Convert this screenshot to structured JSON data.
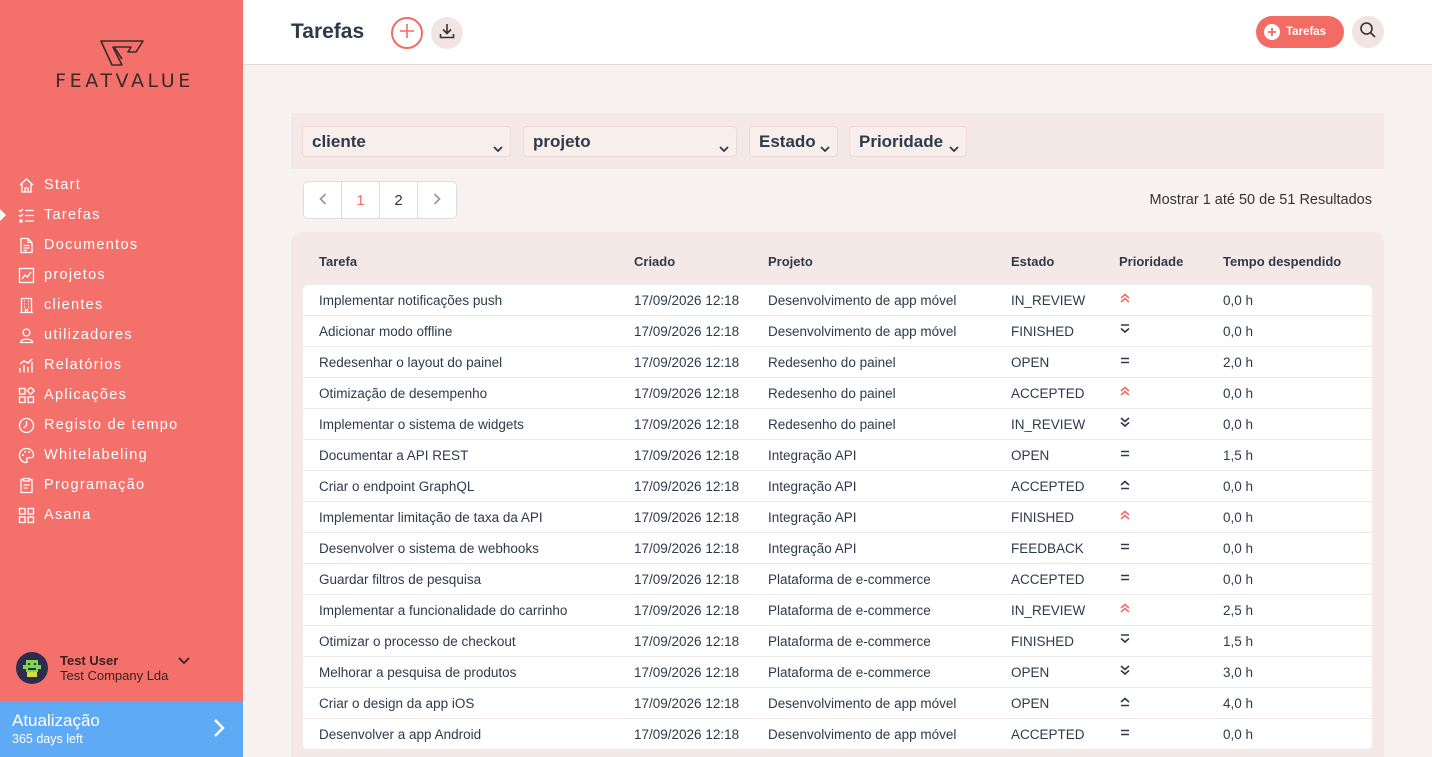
{
  "brand": {
    "name": "FEATVALUE"
  },
  "sidebar": {
    "items": [
      {
        "label": "Start",
        "icon": "home-icon"
      },
      {
        "label": "Tarefas",
        "icon": "task-list-icon",
        "active": true
      },
      {
        "label": "Documentos",
        "icon": "document-icon"
      },
      {
        "label": "projetos",
        "icon": "chart-icon"
      },
      {
        "label": "clientes",
        "icon": "building-icon"
      },
      {
        "label": "utilizadores",
        "icon": "user-icon"
      },
      {
        "label": "Relatórios",
        "icon": "bar-chart-icon"
      },
      {
        "label": "Aplicações",
        "icon": "apps-icon"
      },
      {
        "label": "Registo de tempo",
        "icon": "clock-icon"
      },
      {
        "label": "Whitelabeling",
        "icon": "palette-icon"
      },
      {
        "label": "Programação",
        "icon": "clipboard-icon"
      },
      {
        "label": "Asana",
        "icon": "grid-icon"
      }
    ],
    "user": {
      "name": "Test User",
      "company": "Test Company Lda"
    },
    "upgrade": {
      "title": "Atualização",
      "subtitle": "365 days left"
    }
  },
  "header": {
    "title": "Tarefas",
    "tarefas_button": "Tarefas"
  },
  "filters": {
    "cliente": "cliente",
    "projeto": "projeto",
    "estado": "Estado",
    "prioridade": "Prioridade"
  },
  "pagination": {
    "pages": [
      "1",
      "2"
    ],
    "current": "1",
    "results_text": "Mostrar 1 até 50 de 51 Resultados"
  },
  "table": {
    "columns": [
      "Tarefa",
      "Criado",
      "Projeto",
      "Estado",
      "Prioridade",
      "Tempo despendido"
    ],
    "rows": [
      {
        "tarefa": "Implementar notificações push",
        "criado": "17/09/2026 12:18",
        "projeto": "Desenvolvimento de app móvel",
        "estado": "IN_REVIEW",
        "prioridade": "highest",
        "tempo": "0,0 h"
      },
      {
        "tarefa": "Adicionar modo offline",
        "criado": "17/09/2026 12:18",
        "projeto": "Desenvolvimento de app móvel",
        "estado": "FINISHED",
        "prioridade": "low",
        "tempo": "0,0 h"
      },
      {
        "tarefa": "Redesenhar o layout do painel",
        "criado": "17/09/2026 12:18",
        "projeto": "Redesenho do painel",
        "estado": "OPEN",
        "prioridade": "medium",
        "tempo": "2,0 h"
      },
      {
        "tarefa": "Otimização de desempenho",
        "criado": "17/09/2026 12:18",
        "projeto": "Redesenho do painel",
        "estado": "ACCEPTED",
        "prioridade": "highest",
        "tempo": "0,0 h"
      },
      {
        "tarefa": "Implementar o sistema de widgets",
        "criado": "17/09/2026 12:18",
        "projeto": "Redesenho do painel",
        "estado": "IN_REVIEW",
        "prioridade": "lowest",
        "tempo": "0,0 h"
      },
      {
        "tarefa": "Documentar a API REST",
        "criado": "17/09/2026 12:18",
        "projeto": "Integração API",
        "estado": "OPEN",
        "prioridade": "medium",
        "tempo": "1,5 h"
      },
      {
        "tarefa": "Criar o endpoint GraphQL",
        "criado": "17/09/2026 12:18",
        "projeto": "Integração API",
        "estado": "ACCEPTED",
        "prioridade": "high",
        "tempo": "0,0 h"
      },
      {
        "tarefa": "Implementar limitação de taxa da API",
        "criado": "17/09/2026 12:18",
        "projeto": "Integração API",
        "estado": "FINISHED",
        "prioridade": "highest",
        "tempo": "0,0 h"
      },
      {
        "tarefa": "Desenvolver o sistema de webhooks",
        "criado": "17/09/2026 12:18",
        "projeto": "Integração API",
        "estado": "FEEDBACK",
        "prioridade": "medium",
        "tempo": "0,0 h"
      },
      {
        "tarefa": "Guardar filtros de pesquisa",
        "criado": "17/09/2026 12:18",
        "projeto": "Plataforma de e-commerce",
        "estado": "ACCEPTED",
        "prioridade": "medium",
        "tempo": "0,0 h"
      },
      {
        "tarefa": "Implementar a funcionalidade do carrinho",
        "criado": "17/09/2026 12:18",
        "projeto": "Plataforma de e-commerce",
        "estado": "IN_REVIEW",
        "prioridade": "highest",
        "tempo": "2,5 h"
      },
      {
        "tarefa": "Otimizar o processo de checkout",
        "criado": "17/09/2026 12:18",
        "projeto": "Plataforma de e-commerce",
        "estado": "FINISHED",
        "prioridade": "low",
        "tempo": "1,5 h"
      },
      {
        "tarefa": "Melhorar a pesquisa de produtos",
        "criado": "17/09/2026 12:18",
        "projeto": "Plataforma de e-commerce",
        "estado": "OPEN",
        "prioridade": "lowest",
        "tempo": "3,0 h"
      },
      {
        "tarefa": "Criar o design da app iOS",
        "criado": "17/09/2026 12:18",
        "projeto": "Desenvolvimento de app móvel",
        "estado": "OPEN",
        "prioridade": "high",
        "tempo": "4,0 h"
      },
      {
        "tarefa": "Desenvolver a app Android",
        "criado": "17/09/2026 12:18",
        "projeto": "Desenvolvimento de app móvel",
        "estado": "ACCEPTED",
        "prioridade": "medium",
        "tempo": "0,0 h"
      }
    ]
  },
  "colors": {
    "sidebar": "#f4716b",
    "accent": "#f26c64",
    "upgrade": "#5eaaf5",
    "text": "#2e3a4b"
  }
}
